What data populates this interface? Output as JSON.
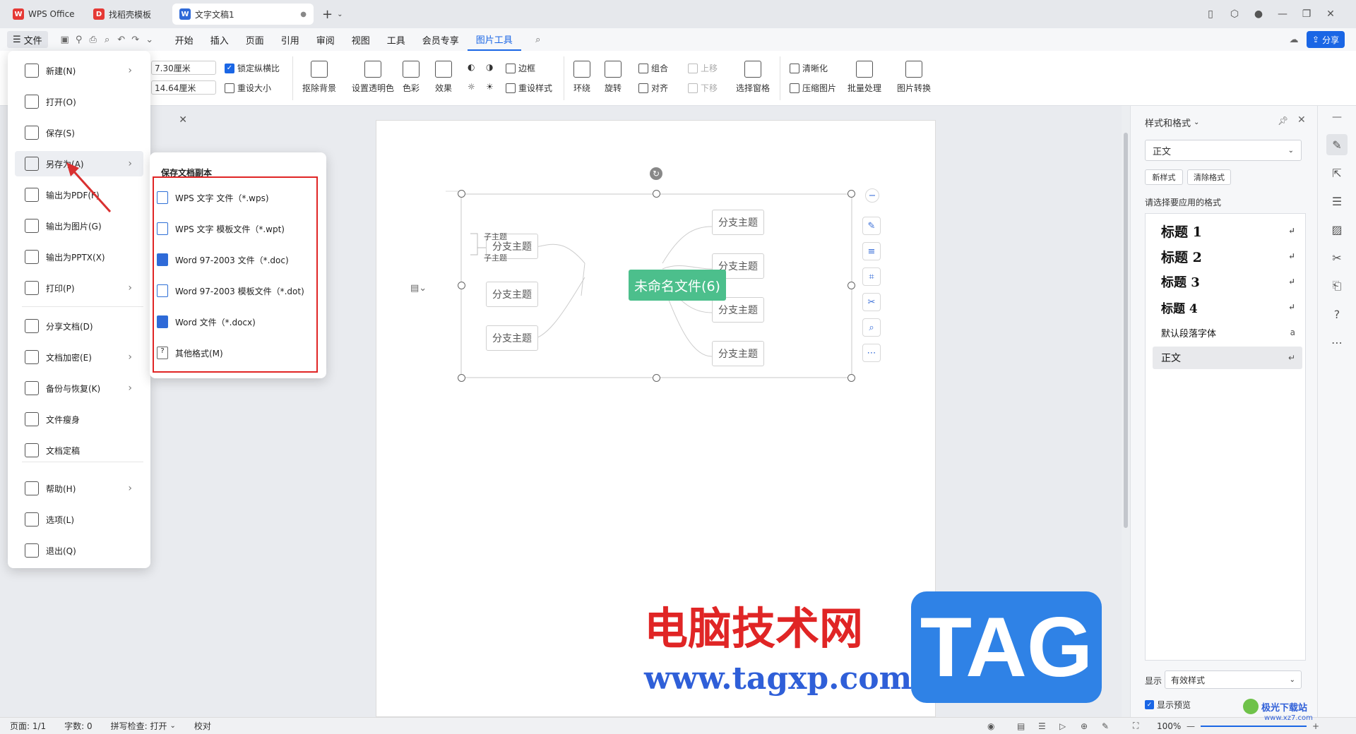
{
  "titlebar": {
    "tabs": [
      {
        "label": "WPS Office",
        "icon": "wps-logo-icon",
        "color": "#e53935"
      },
      {
        "label": "找稻壳模板",
        "icon": "docer-logo-icon",
        "color": "#e53935"
      },
      {
        "label": "文字文稿1",
        "icon": "word-doc-icon",
        "color": "#2f6ad8"
      }
    ],
    "new_tab": "+"
  },
  "menubar": {
    "file_label": "文件",
    "items": [
      "开始",
      "插入",
      "页面",
      "引用",
      "审阅",
      "视图",
      "工具",
      "会员专享",
      "图片工具"
    ],
    "active_item": "图片工具",
    "share_label": "分享"
  },
  "ribbon": {
    "width_value": "7.30厘米",
    "height_value": "14.64厘米",
    "lock_ratio": "锁定纵横比",
    "reset_size": "重设大小",
    "remove_bg": "抠除背景",
    "set_transparent": "设置透明色",
    "color": "色彩",
    "effects": "效果",
    "border": "边框",
    "reset_style": "重设样式",
    "wrap": "环绕",
    "rotate": "旋转",
    "group": "组合",
    "align": "对齐",
    "move_up": "上移",
    "move_down": "下移",
    "select_pane": "选择窗格",
    "sharpen": "清晰化",
    "compress": "压缩图片",
    "batch": "批量处理",
    "convert": "图片转换"
  },
  "file_menu": {
    "items": [
      {
        "label": "新建(N)",
        "icon": "new-file-icon",
        "arrow": true
      },
      {
        "label": "打开(O)",
        "icon": "open-folder-icon",
        "arrow": false
      },
      {
        "label": "保存(S)",
        "icon": "save-icon",
        "arrow": false
      },
      {
        "label": "另存为(A)",
        "icon": "save-as-icon",
        "arrow": true
      },
      {
        "label": "输出为PDF(F)",
        "icon": "export-pdf-icon",
        "arrow": false
      },
      {
        "label": "输出为图片(G)",
        "icon": "export-image-icon",
        "arrow": false
      },
      {
        "label": "输出为PPTX(X)",
        "icon": "export-pptx-icon",
        "arrow": false
      },
      {
        "label": "打印(P)",
        "icon": "print-icon",
        "arrow": true
      },
      {
        "label": "分享文档(D)",
        "icon": "share-icon",
        "arrow": false
      },
      {
        "label": "文档加密(E)",
        "icon": "encrypt-icon",
        "arrow": true
      },
      {
        "label": "备份与恢复(K)",
        "icon": "backup-icon",
        "arrow": true
      },
      {
        "label": "文件瘦身",
        "icon": "slim-icon",
        "arrow": false
      },
      {
        "label": "文档定稿",
        "icon": "finalize-icon",
        "arrow": false
      },
      {
        "label": "帮助(H)",
        "icon": "help-icon",
        "arrow": true
      },
      {
        "label": "选项(L)",
        "icon": "options-icon",
        "arrow": false
      },
      {
        "label": "退出(Q)",
        "icon": "exit-icon",
        "arrow": false
      }
    ]
  },
  "save_as_submenu": {
    "title": "保存文档副本",
    "items": [
      {
        "label": "WPS 文字 文件（*.wps)",
        "icon": "wps-file-icon"
      },
      {
        "label": "WPS 文字 模板文件（*.wpt)",
        "icon": "wps-template-icon"
      },
      {
        "label": "Word 97-2003 文件（*.doc)",
        "icon": "word-doc-icon"
      },
      {
        "label": "Word 97-2003 模板文件（*.dot)",
        "icon": "word-template-icon"
      },
      {
        "label": "Word 文件（*.docx)",
        "icon": "word-docx-icon"
      },
      {
        "label": "其他格式(M)",
        "icon": "other-format-icon"
      }
    ]
  },
  "mindmap": {
    "center": "未命名文件(6)",
    "left_nodes": [
      "分支主题",
      "分支主题",
      "分支主题"
    ],
    "right_nodes": [
      "分支主题",
      "分支主题",
      "分支主题",
      "分支主题"
    ],
    "sub_nodes": [
      "子主题",
      "子主题"
    ],
    "center_color": "#4cbf8c"
  },
  "right_panel": {
    "title": "样式和格式",
    "current_style": "正文",
    "new_style": "新样式",
    "clear_format": "清除格式",
    "prompt": "请选择要应用的格式",
    "styles": [
      "标题  1",
      "标题  2",
      "标题  3",
      "标题  4",
      "默认段落字体",
      "正文"
    ],
    "show_label": "显示",
    "show_value": "有效样式",
    "preview_label": "显示预览"
  },
  "watermark": {
    "cn_title": "电脑技术网",
    "url": "www.tagxp.com",
    "tag": "TAG",
    "site": "极光下载站",
    "site_url": "www.xz7.com"
  },
  "statusbar": {
    "page": "页面: 1/1",
    "words": "字数: 0",
    "spellcheck": "拼写检查: 打开",
    "proofread": "校对",
    "zoom": "100%"
  },
  "colors": {
    "accent": "#1a66e5",
    "highlight_red": "#e02525"
  }
}
